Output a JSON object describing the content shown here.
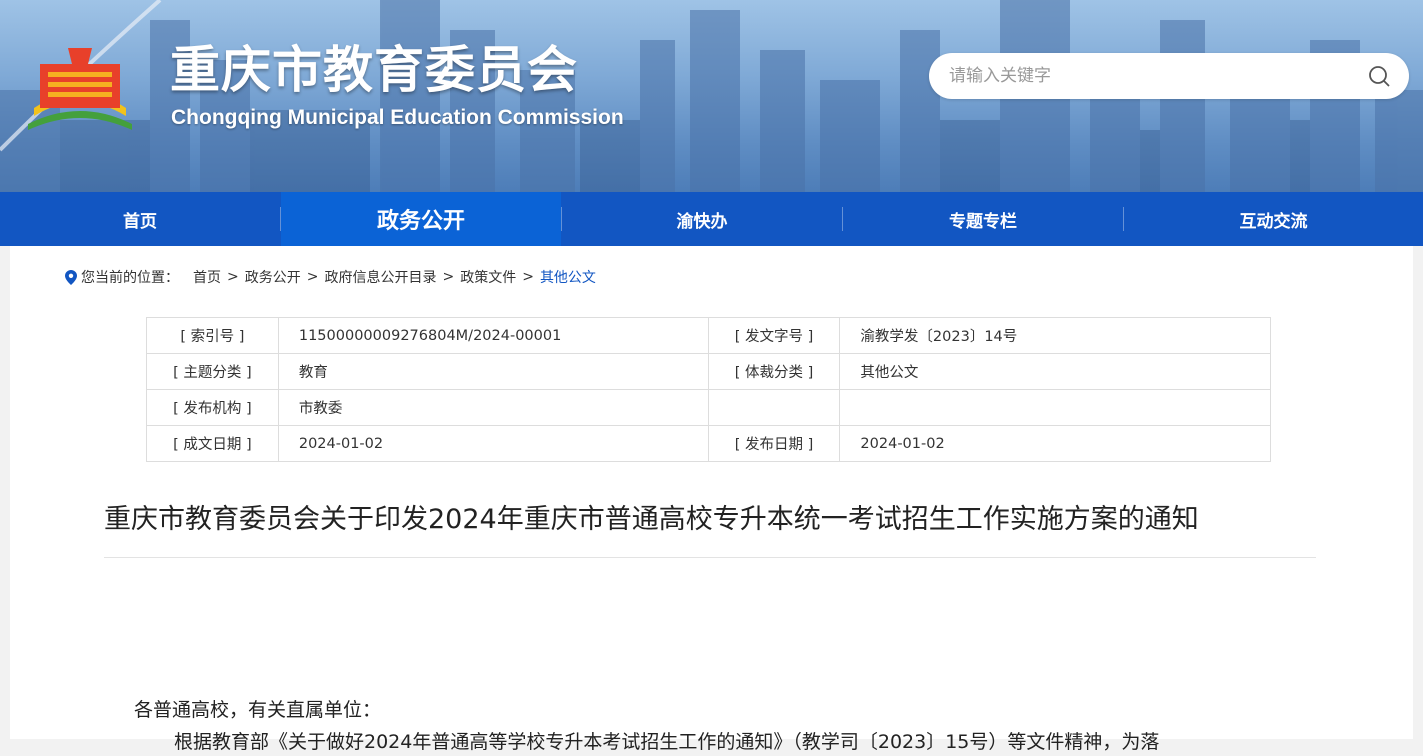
{
  "header": {
    "title_cn": "重庆市教育委员会",
    "title_en": "Chongqing Municipal Education Commission",
    "logo_icon": "cq-education-logo-icon"
  },
  "search": {
    "placeholder": "请输入关键字",
    "value": "",
    "icon": "search-icon"
  },
  "nav": {
    "items": [
      {
        "label": "首页",
        "active": false
      },
      {
        "label": "政务公开",
        "active": true
      },
      {
        "label": "渝快办",
        "active": false
      },
      {
        "label": "专题专栏",
        "active": false
      },
      {
        "label": "互动交流",
        "active": false
      }
    ]
  },
  "breadcrumb": {
    "label": "您当前的位置：",
    "items": [
      "首页",
      "政务公开",
      "政府信息公开目录",
      "政策文件"
    ],
    "current": "其他公文",
    "separator": ">"
  },
  "meta": {
    "rows": [
      {
        "k1": "[ 索引号 ]",
        "v1": "11500000009276804M/2024-00001",
        "k2": "[ 发文字号 ]",
        "v2": "渝教学发〔2023〕14号"
      },
      {
        "k1": "[ 主题分类 ]",
        "v1": "教育",
        "k2": "[ 体裁分类 ]",
        "v2": "其他公文"
      },
      {
        "k1": "[ 发布机构 ]",
        "v1": "市教委",
        "k2": "",
        "v2": ""
      },
      {
        "k1": "[ 成文日期 ]",
        "v1": "2024-01-02",
        "k2": "[ 发布日期 ]",
        "v2": "2024-01-02"
      }
    ]
  },
  "doc": {
    "title": "重庆市教育委员会关于印发2024年重庆市普通高校专升本统一考试招生工作实施方案的通知",
    "salutation": "各普通高校，有关直属单位：",
    "first_line": "根据教育部《关于做好2024年普通高等学校专升本考试招生工作的通知》（教学司〔2023〕15号）等文件精神，为落"
  },
  "colors": {
    "nav_bg": "#1256c2",
    "nav_active": "#0b63d6",
    "breadcrumb_current": "#1256c2"
  }
}
